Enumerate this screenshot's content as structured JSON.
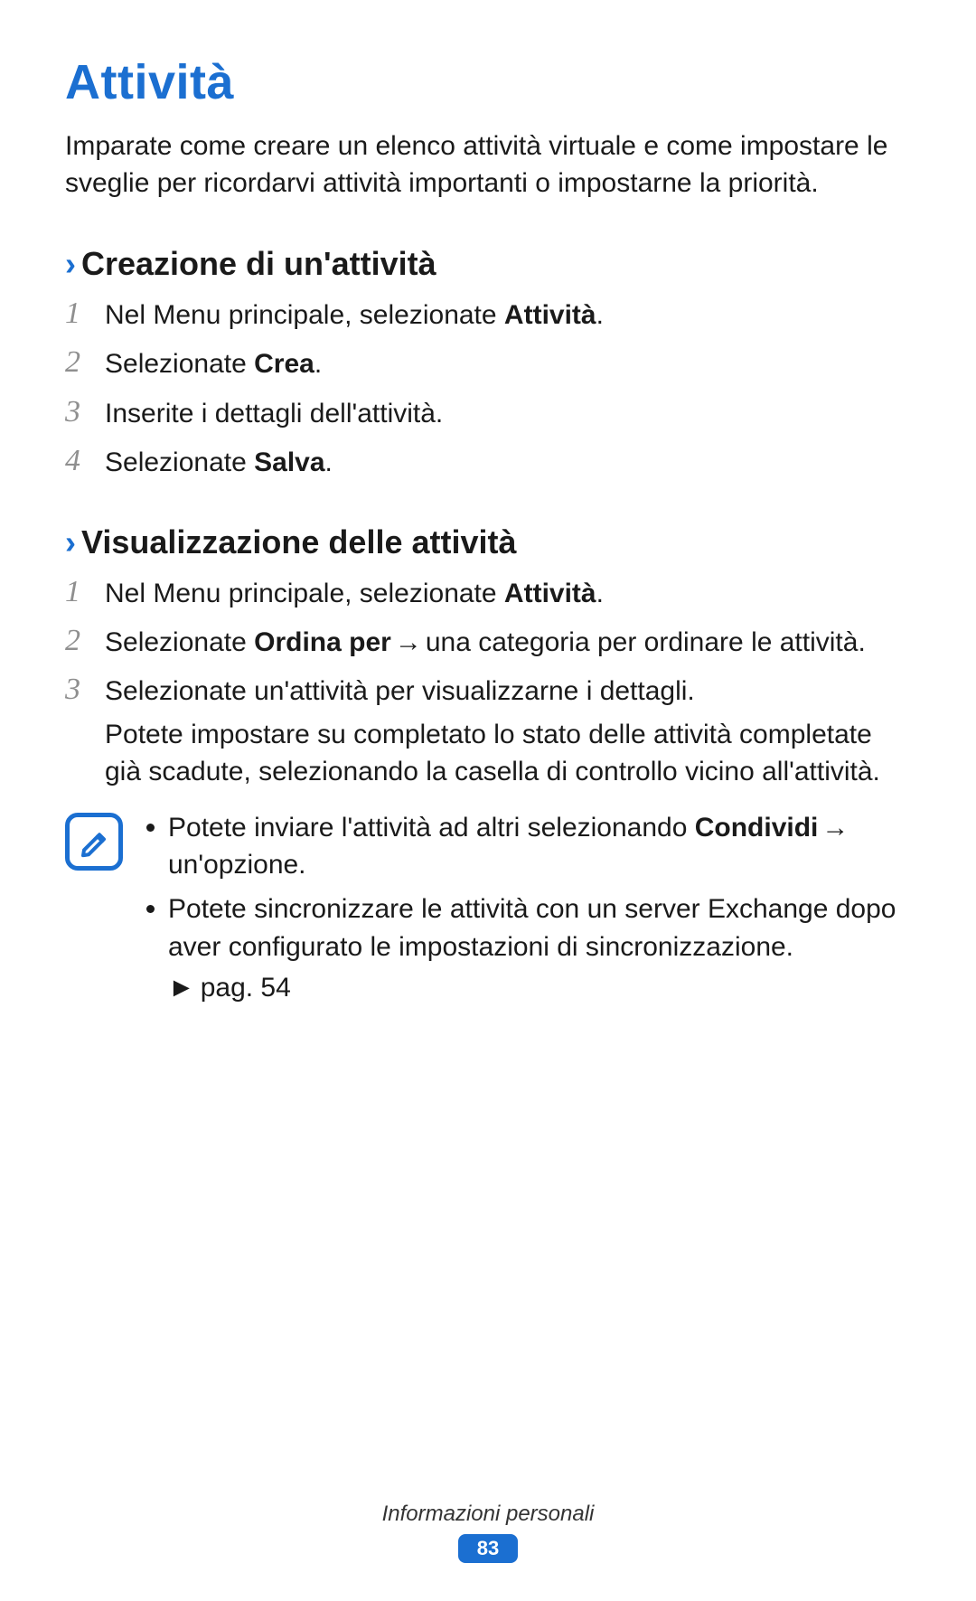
{
  "title": "Attività",
  "intro": "Imparate come creare un elenco attività virtuale e come impostare le sveglie per ricordarvi attività importanti o impostarne la priorità.",
  "section1": {
    "heading": "Creazione di un'attività",
    "steps": {
      "s1_pre": "Nel Menu principale, selezionate ",
      "s1_bold": "Attività",
      "s1_post": ".",
      "s2_pre": "Selezionate ",
      "s2_bold": "Crea",
      "s2_post": ".",
      "s3": "Inserite i dettagli dell'attività.",
      "s4_pre": "Selezionate ",
      "s4_bold": "Salva",
      "s4_post": "."
    }
  },
  "section2": {
    "heading": "Visualizzazione delle attività",
    "steps": {
      "s1_pre": "Nel Menu principale, selezionate ",
      "s1_bold": "Attività",
      "s1_post": ".",
      "s2_pre": "Selezionate ",
      "s2_bold": "Ordina per",
      "s2_arrow": " → ",
      "s2_post": "una categoria per ordinare le attività.",
      "s3_line1": "Selezionate un'attività per visualizzarne i dettagli.",
      "s3_line2": "Potete impostare su completato lo stato delle attività completate già scadute, selezionando la casella di controllo vicino all'attività."
    }
  },
  "note": {
    "b1_pre": "Potete inviare l'attività ad altri selezionando ",
    "b1_bold": "Condividi",
    "b1_arrow": " → ",
    "b1_post": "un'opzione.",
    "b2": "Potete sincronizzare le attività con un server Exchange dopo aver configurato le impostazioni di sincronizzazione.",
    "pageref_tri": "►",
    "pageref": "pag. 54"
  },
  "footer": {
    "section": "Informazioni personali",
    "page": "83"
  },
  "nums": {
    "n1": "1",
    "n2": "2",
    "n3": "3",
    "n4": "4"
  },
  "chevron": "›"
}
